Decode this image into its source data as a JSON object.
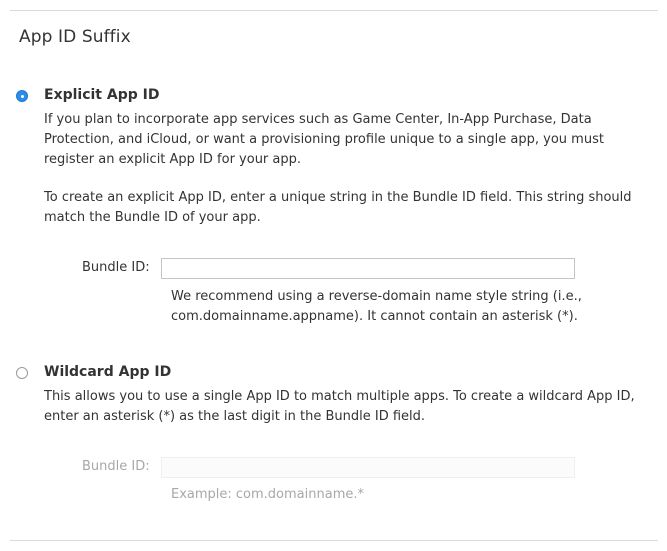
{
  "section": {
    "title": "App ID Suffix"
  },
  "explicit": {
    "label": "Explicit App ID",
    "selected": true,
    "description_1": "If you plan to incorporate app services such as Game Center, In-App Purchase, Data Protection, and iCloud, or want a provisioning profile unique to a single app, you must register an explicit App ID for your app.",
    "description_2": "To create an explicit App ID, enter a unique string in the Bundle ID field. This string should match the Bundle ID of your app.",
    "bundle_id_label": "Bundle ID:",
    "bundle_id_value": "",
    "hint": "We recommend using a reverse-domain name style string (i.e., com.domainname.appname). It cannot contain an asterisk (*)."
  },
  "wildcard": {
    "label": "Wildcard App ID",
    "selected": false,
    "description": "This allows you to use a single App ID to match multiple apps. To create a wildcard App ID, enter an asterisk (*) as the last digit in the Bundle ID field.",
    "bundle_id_label": "Bundle ID:",
    "bundle_id_value": "",
    "hint": "Example: com.domainname.*"
  },
  "colors": {
    "accent": "#2b8ce8",
    "text": "#333333",
    "disabled_text": "#a8a8a8",
    "divider": "#d9d9d9"
  }
}
